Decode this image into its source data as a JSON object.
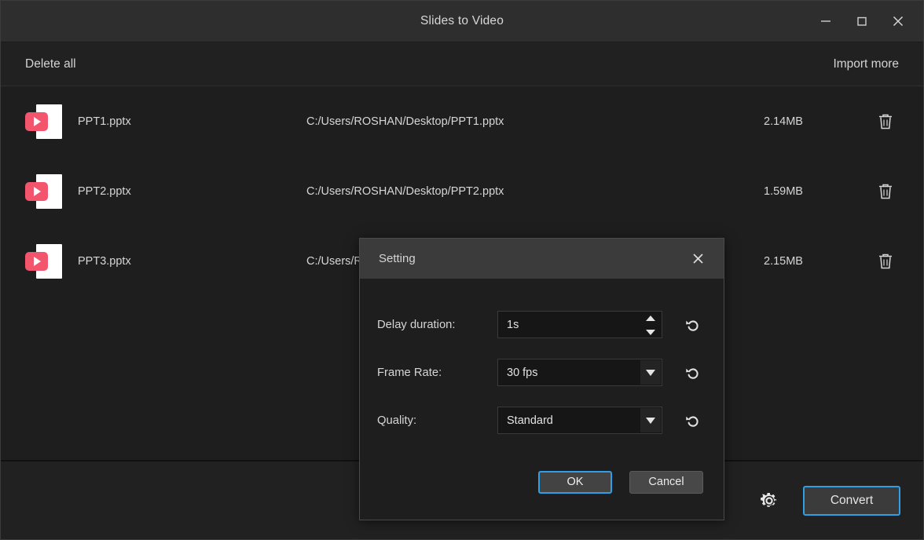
{
  "window": {
    "title": "Slides to Video",
    "controls": [
      {
        "name": "minimize-button",
        "label": "—"
      },
      {
        "name": "maximize-button",
        "label": "□"
      },
      {
        "name": "close-button",
        "label": "✕"
      }
    ]
  },
  "toolbar": {
    "delete_all_label": "Delete all",
    "import_more_label": "Import more"
  },
  "files": [
    {
      "icon": "powerpoint-file-icon",
      "name": "PPT1.pptx",
      "path": "C:/Users/ROSHAN/Desktop/PPT1.pptx",
      "size": "2.14MB",
      "delete_icon": "trash-icon"
    },
    {
      "icon": "powerpoint-file-icon",
      "name": "PPT2.pptx",
      "path": "C:/Users/ROSHAN/Desktop/PPT2.pptx",
      "size": "1.59MB",
      "delete_icon": "trash-icon"
    },
    {
      "icon": "powerpoint-file-icon",
      "name": "PPT3.pptx",
      "path": "C:/Users/ROSHAN/Desktop/PPT3.pptx",
      "size": "2.15MB",
      "delete_icon": "trash-icon"
    }
  ],
  "bottom_bar": {
    "settings_icon": "gear-icon",
    "convert_label": "Convert"
  },
  "dialog": {
    "title": "Setting",
    "close_icon": "close-icon",
    "fields": [
      {
        "label": "Delay duration:",
        "value": "1s",
        "control": "spinner",
        "reset_icon": "reset-icon"
      },
      {
        "label": "Frame Rate:",
        "value": "30 fps",
        "control": "dropdown",
        "reset_icon": "reset-icon"
      },
      {
        "label": "Quality:",
        "value": "Standard",
        "control": "dropdown",
        "reset_icon": "reset-icon"
      }
    ],
    "ok_label": "OK",
    "cancel_label": "Cancel"
  },
  "colors": {
    "accent_blue": "#2f9fe3",
    "ppt_pink": "#f2556c",
    "window_bg": "#1e1e1e",
    "titlebar_bg": "#2e2e2e",
    "dialog_header_bg": "#3b3b3b"
  }
}
